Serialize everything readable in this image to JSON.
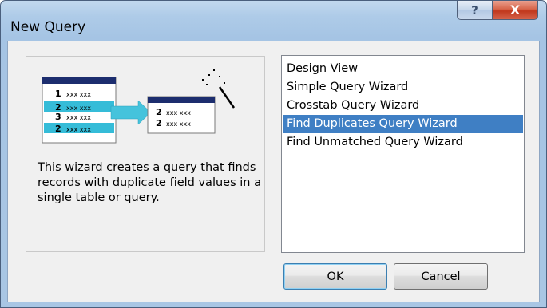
{
  "window": {
    "title": "New Query",
    "help_label": "?",
    "close_label": "X"
  },
  "illustration": {
    "left_table_rows": [
      {
        "num": "1",
        "text": "xxx xxx"
      },
      {
        "num": "2",
        "text": "xxx xxx"
      },
      {
        "num": "3",
        "text": "xxx xxx"
      },
      {
        "num": "2",
        "text": "xxx xxx"
      }
    ],
    "right_table_rows": [
      {
        "num": "2",
        "text": "xxx xxx"
      },
      {
        "num": "2",
        "text": "xxx xxx"
      }
    ],
    "colors": {
      "header": "#1c2d6e",
      "highlight": "#35bcd8",
      "arrow": "#45c3dc"
    },
    "icons": [
      "magic-wand-icon",
      "sparkle-icon",
      "arrow-icon"
    ]
  },
  "description": "This wizard creates a query that finds records with duplicate field values in a single table or query.",
  "query_types": {
    "items": [
      "Design View",
      "Simple Query Wizard",
      "Crosstab Query Wizard",
      "Find Duplicates Query Wizard",
      "Find Unmatched Query Wizard"
    ],
    "selected": "Find Duplicates Query Wizard",
    "selected_color": "#3f7fc4"
  },
  "buttons": {
    "ok": "OK",
    "cancel": "Cancel"
  }
}
